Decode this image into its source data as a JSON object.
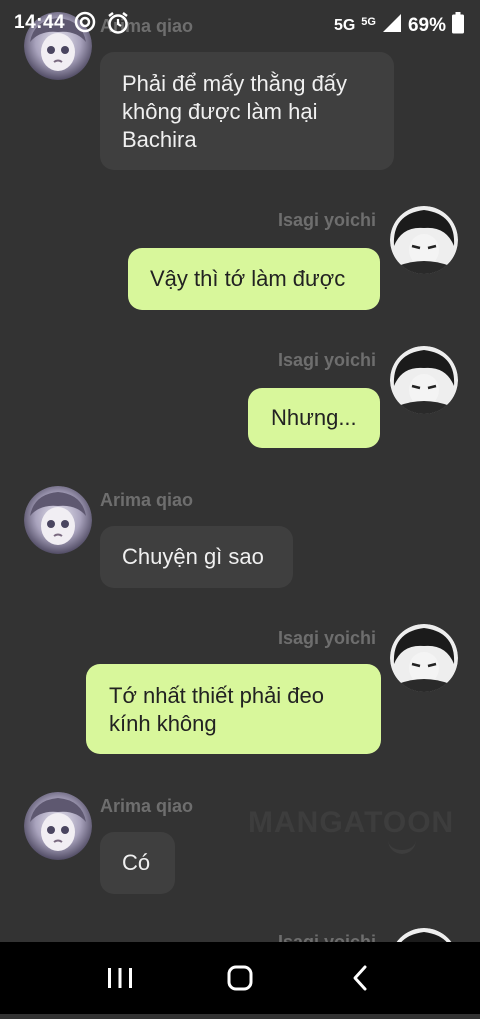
{
  "status": {
    "time": "14:44",
    "network": "5G",
    "network_small": "5G",
    "battery": "69%"
  },
  "messages": [
    {
      "sender": "Arima qiao",
      "text": "Phải để mấy thằng đấy không được làm hại Bachira",
      "side": "left"
    },
    {
      "sender": "Isagi yoichi",
      "text": "Vậy thì tớ làm được",
      "side": "right"
    },
    {
      "sender": "Isagi yoichi",
      "text": "Nhưng...",
      "side": "right"
    },
    {
      "sender": "Arima qiao",
      "text": "Chuyện gì sao",
      "side": "left"
    },
    {
      "sender": "Isagi yoichi",
      "text": "Tớ nhất thiết phải đeo kính không",
      "side": "right"
    },
    {
      "sender": "Arima qiao",
      "text": "Có",
      "side": "left"
    },
    {
      "sender": "Isagi yoichi",
      "text": "",
      "side": "right"
    }
  ],
  "watermark": "MANGATOON",
  "nav": {
    "recent": "recent-apps-icon",
    "home": "home-icon",
    "back": "back-icon"
  }
}
